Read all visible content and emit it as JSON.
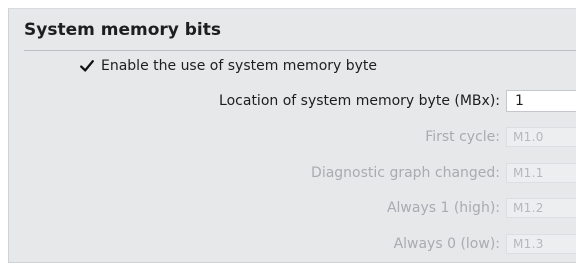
{
  "section": {
    "title": "System memory bits"
  },
  "enable_checkbox": {
    "label": "Enable the use of system memory byte",
    "checked": true
  },
  "location": {
    "label": "Location of system memory byte (MBx):",
    "value": "1"
  },
  "bits": [
    {
      "label": "First cycle:",
      "value": "M1.0"
    },
    {
      "label": "Diagnostic graph changed:",
      "value": "M1.1"
    },
    {
      "label": "Always 1 (high):",
      "value": "M1.2"
    },
    {
      "label": "Always 0 (low):",
      "value": "M1.3"
    }
  ],
  "colors": {
    "panel_background": "#e6e8ea",
    "text_active": "#1e1e1e",
    "text_disabled": "#a8acb0",
    "input_background": "#ffffff"
  }
}
